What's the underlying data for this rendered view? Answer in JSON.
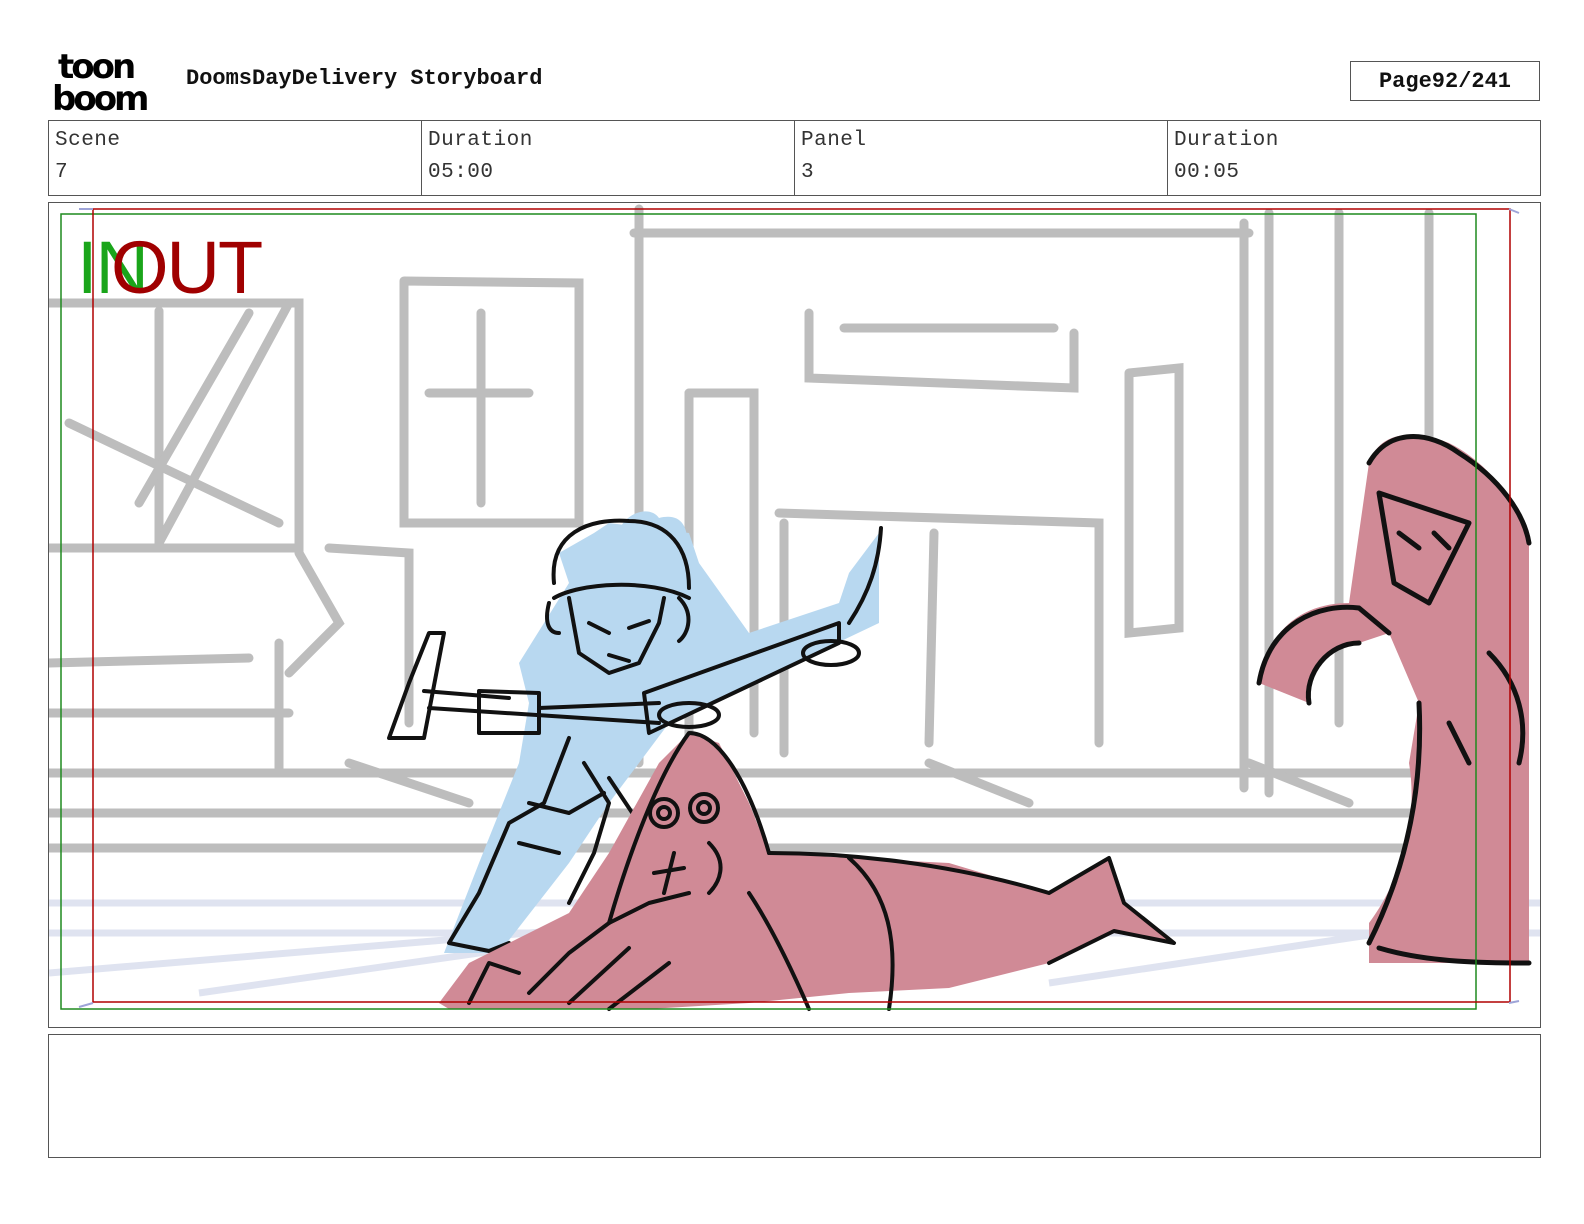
{
  "brand": {
    "logo_text_top": "toon",
    "logo_text_bottom": "boom"
  },
  "header": {
    "title": "DoomsDayDelivery Storyboard",
    "page_label": "Page",
    "page_value": "92/241"
  },
  "info": {
    "scene_label": "Scene",
    "scene_value": "7",
    "scene_duration_label": "Duration",
    "scene_duration_value": "05:00",
    "panel_label": "Panel",
    "panel_value": "3",
    "panel_duration_label": "Duration",
    "panel_duration_value": "00:05"
  },
  "panel": {
    "in_marker": "IN",
    "out_marker": "OUT",
    "colors": {
      "in_frame": "#1f8a1f",
      "out_frame": "#b00000",
      "hero_fill": "#b8d8f0",
      "cloak_fill": "#d08a96",
      "sketch_gray": "#bdbdbd"
    }
  },
  "notes": {
    "text": ""
  }
}
